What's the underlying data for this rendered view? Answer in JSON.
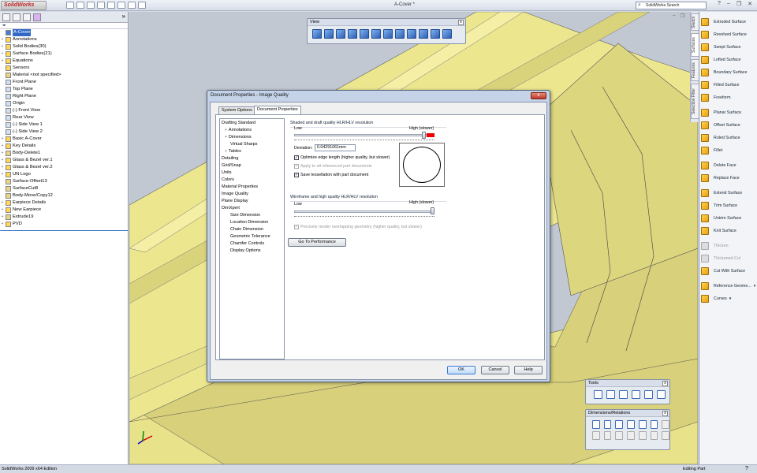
{
  "app": {
    "logo": "SolidWorks",
    "window_title": "A-Cover *",
    "search_placeholder": "SolidWorks Search",
    "status_left": "SolidWorks 2009 x64 Edition",
    "status_right": "Editing Part"
  },
  "tree": {
    "items": [
      {
        "label": "A-Cover",
        "exp": "",
        "icon": "blue",
        "sel": true
      },
      {
        "label": "Annotations",
        "exp": "+",
        "icon": "folder"
      },
      {
        "label": "Solid Bodies(30)",
        "exp": "+",
        "icon": "folder"
      },
      {
        "label": "Surface Bodies(21)",
        "exp": "+",
        "icon": "folder"
      },
      {
        "label": "Equations",
        "exp": "+",
        "icon": "folder"
      },
      {
        "label": "Sensors",
        "exp": "",
        "icon": "folder"
      },
      {
        "label": "Material <not specified>",
        "exp": "",
        "icon": "feat"
      },
      {
        "label": "Front Plane",
        "exp": "",
        "icon": "plane"
      },
      {
        "label": "Top Plane",
        "exp": "",
        "icon": "plane"
      },
      {
        "label": "Right Plane",
        "exp": "",
        "icon": "plane"
      },
      {
        "label": "Origin",
        "exp": "",
        "icon": "plane"
      },
      {
        "label": "(-) Front View",
        "exp": "",
        "icon": "plane"
      },
      {
        "label": "Rear View",
        "exp": "",
        "icon": "plane"
      },
      {
        "label": "(-) Side View 1",
        "exp": "",
        "icon": "plane"
      },
      {
        "label": "(-) Side View 2",
        "exp": "",
        "icon": "plane"
      },
      {
        "label": "Basic A-Cover",
        "exp": "+",
        "icon": "folder"
      },
      {
        "label": "Key Details",
        "exp": "+",
        "icon": "folder"
      },
      {
        "label": "Body-Delete1",
        "exp": "+",
        "icon": "feat"
      },
      {
        "label": "Glass & Bezel ver.1",
        "exp": "+",
        "icon": "folder"
      },
      {
        "label": "Glass & Bezel ver.2",
        "exp": "+",
        "icon": "folder"
      },
      {
        "label": "UN Logo",
        "exp": "+",
        "icon": "folder"
      },
      {
        "label": "Surface-Offset13",
        "exp": "",
        "icon": "feat"
      },
      {
        "label": "SurfaceCut8",
        "exp": "",
        "icon": "feat"
      },
      {
        "label": "Body-Move/Copy12",
        "exp": "",
        "icon": "feat"
      },
      {
        "label": "Earpiece Details",
        "exp": "+",
        "icon": "folder"
      },
      {
        "label": "New Earpiece",
        "exp": "+",
        "icon": "folder"
      },
      {
        "label": "Extrude19",
        "exp": "+",
        "icon": "feat"
      },
      {
        "label": "PVD",
        "exp": "+",
        "icon": "folder"
      }
    ]
  },
  "view_toolbar": {
    "title": "View",
    "close": "x"
  },
  "tools_toolbar": {
    "title": "Tools",
    "close": "x"
  },
  "dims_toolbar": {
    "title": "Dimensions/Relations",
    "close": "x"
  },
  "right_tabs": [
    "Sketch",
    "Surfaces",
    "Features",
    "Selection Filter"
  ],
  "surfaces": [
    {
      "label": "Extruded Surface",
      "dis": false
    },
    {
      "label": "Revolved Surface",
      "dis": false
    },
    {
      "label": "Swept Surface",
      "dis": false
    },
    {
      "label": "Lofted Surface",
      "dis": false
    },
    {
      "label": "Boundary Surface",
      "dis": false
    },
    {
      "label": "Filled Surface",
      "dis": false
    },
    {
      "label": "Freeform",
      "dis": false
    },
    {
      "label": "Planar Surface",
      "dis": false
    },
    {
      "label": "Offset Surface",
      "dis": false
    },
    {
      "label": "Ruled Surface",
      "dis": false
    },
    {
      "label": "Fillet",
      "dis": false
    },
    {
      "label": "Delete Face",
      "dis": false
    },
    {
      "label": "Replace Face",
      "dis": false
    },
    {
      "label": "Extend Surface",
      "dis": false
    },
    {
      "label": "Trim Surface",
      "dis": false
    },
    {
      "label": "Untrim Surface",
      "dis": false
    },
    {
      "label": "Knit Surface",
      "dis": false
    },
    {
      "label": "Thicken",
      "dis": true
    },
    {
      "label": "Thickened Cut",
      "dis": true
    },
    {
      "label": "Cut With Surface",
      "dis": false
    },
    {
      "label": "Reference Geome...",
      "dis": false,
      "dd": true
    },
    {
      "label": "Curves",
      "dis": false,
      "dd": true
    }
  ],
  "dialog": {
    "title": "Document Properties - Image Quality",
    "close": "x",
    "tabs": [
      "System Options",
      "Document Properties"
    ],
    "tree": [
      {
        "label": "Drafting Standard",
        "ind": false
      },
      {
        "label": "Annotations",
        "ind": true,
        "pl": "+"
      },
      {
        "label": "Dimensions",
        "ind": true,
        "pl": "+"
      },
      {
        "label": "Virtual Sharps",
        "ind": true
      },
      {
        "label": "Tables",
        "ind": true,
        "pl": "+"
      },
      {
        "label": "Detailing",
        "ind": false
      },
      {
        "label": "Grid/Snap",
        "ind": false
      },
      {
        "label": "Units",
        "ind": false
      },
      {
        "label": "Colors",
        "ind": false
      },
      {
        "label": "Material Properties",
        "ind": false
      },
      {
        "label": "Image Quality",
        "ind": false
      },
      {
        "label": "Plane Display",
        "ind": false
      },
      {
        "label": "DimXpert",
        "ind": false
      },
      {
        "label": "Size Dimension",
        "ind": true
      },
      {
        "label": "Location Dimension",
        "ind": true
      },
      {
        "label": "Chain Dimension",
        "ind": true
      },
      {
        "label": "Geometric Tolerance",
        "ind": true
      },
      {
        "label": "Chamfer Controls",
        "ind": true
      },
      {
        "label": "Display Options",
        "ind": true
      }
    ],
    "shaded": {
      "title": "Shaded and draft quality HLR/HLV resolution",
      "low": "Low",
      "high": "High (slower)",
      "slider_value": 0.97,
      "deviation_label": "Deviation:",
      "deviation": "0.04291061mm",
      "opt_edge": "Optimize edge length (higher quality, but slower)",
      "apply_all": "Apply to all referenced part documents",
      "save_tess": "Save tessellation with part document"
    },
    "wireframe": {
      "title": "Wireframe and high quality HLR/HLV resolution",
      "low": "Low",
      "high": "High (slower)",
      "slider_value": 1.0,
      "precisely": "Precisely render overlapping geometry (higher quality, but slower)"
    },
    "perf_button": "Go To Performance",
    "ok": "OK",
    "cancel": "Cancel",
    "help": "Help"
  }
}
